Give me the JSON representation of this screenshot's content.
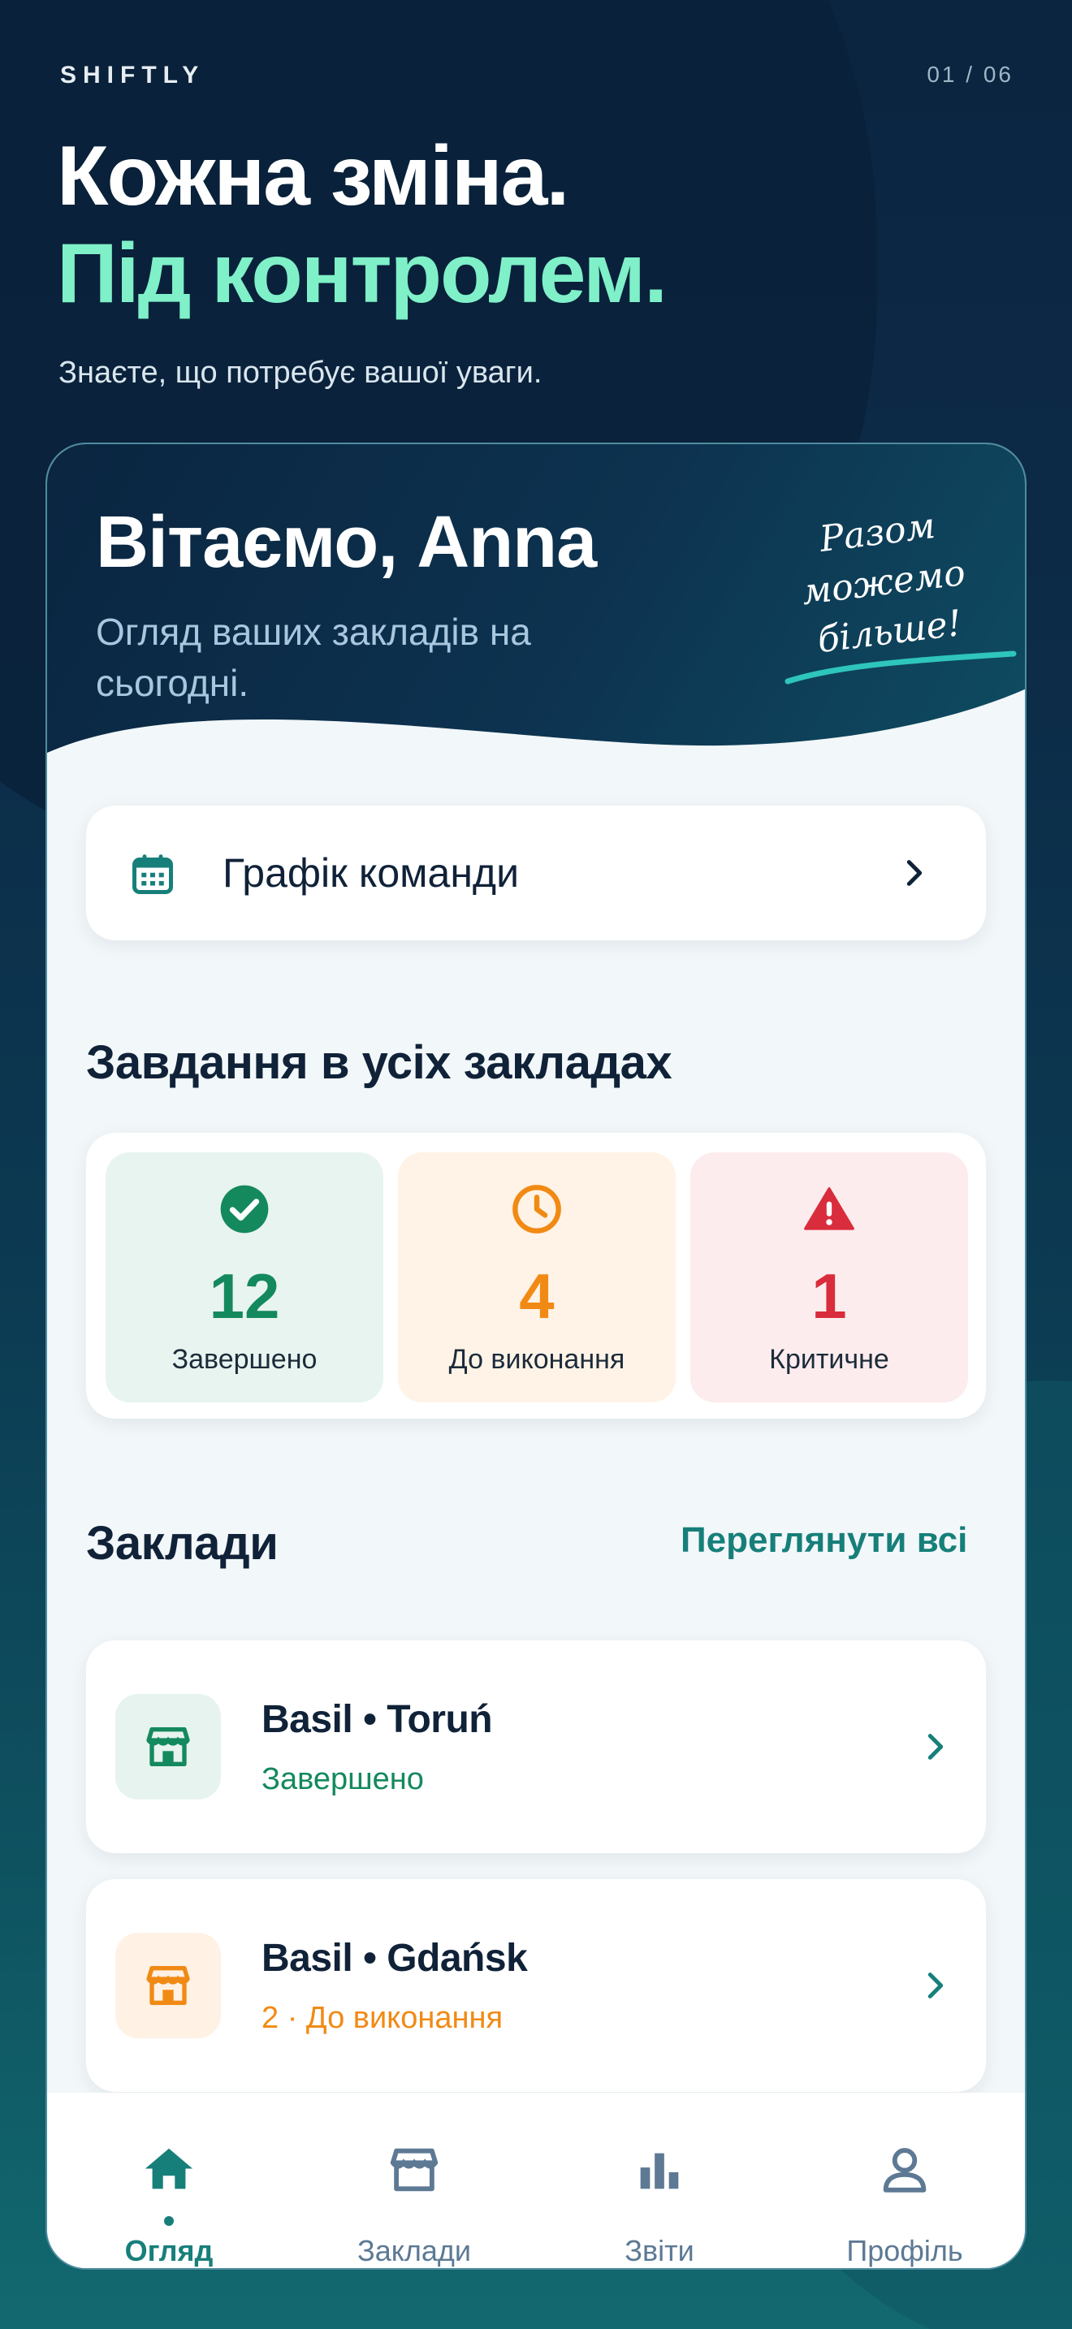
{
  "onboarding": {
    "brand": "SHIFTLY",
    "pager": "01 / 06",
    "headline_line1": "Кожна зміна.",
    "headline_line2": "Під контролем.",
    "subtitle": "Знаєте, що потребує вашої уваги."
  },
  "app": {
    "greeting": "Вітаємо, Anna",
    "greeting_sub": "Огляд ваших закладів на сьогодні.",
    "slogan": "Разом можемо більше!",
    "schedule": {
      "label": "Графік команди",
      "icon": "calendar-icon"
    },
    "tasks": {
      "title": "Завдання в усіх закладах",
      "items": [
        {
          "value": "12",
          "label": "Завершено",
          "icon": "check-circle-icon",
          "color": "#14895e"
        },
        {
          "value": "4",
          "label": "До виконання",
          "icon": "clock-icon",
          "color": "#f18a14"
        },
        {
          "value": "1",
          "label": "Критичне",
          "icon": "warning-icon",
          "color": "#d92c3c"
        }
      ]
    },
    "venues": {
      "title": "Заклади",
      "see_all": "Переглянути всі",
      "items": [
        {
          "name": "Basil • Toruń",
          "status": "Завершено",
          "icon": "store-icon",
          "color": "#14895e"
        },
        {
          "name": "Basil • Gdańsk",
          "status": "2 · До виконання",
          "icon": "store-icon",
          "color": "#f18a14"
        }
      ]
    },
    "tabbar": [
      {
        "label": "Огляд",
        "icon": "home-icon",
        "active": true
      },
      {
        "label": "Заклади",
        "icon": "store-icon",
        "active": false
      },
      {
        "label": "Звіти",
        "icon": "bar-chart-icon",
        "active": false
      },
      {
        "label": "Профіль",
        "icon": "user-icon",
        "active": false
      }
    ],
    "accent": "#177f7a"
  }
}
